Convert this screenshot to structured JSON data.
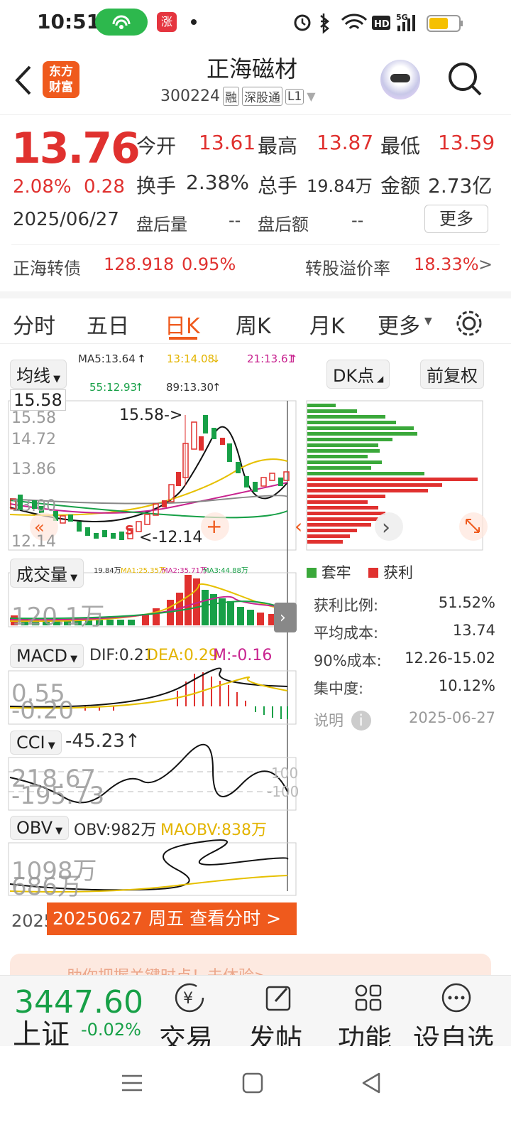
{
  "status": {
    "time": "10:51",
    "app_icon": "涨"
  },
  "header": {
    "title": "正海磁材",
    "code": "300224",
    "badge_rong": "融",
    "badge_sgt": "深股通",
    "badge_l1": "L1",
    "logo_text": "东方\n财富"
  },
  "quote": {
    "price": "13.76",
    "pct": "2.08%",
    "chg": "0.28",
    "date": "2025/06/27",
    "fields": [
      {
        "label": "今开",
        "value": "13.61"
      },
      {
        "label": "最高",
        "value": "13.87"
      },
      {
        "label": "最低",
        "value": "13.59"
      },
      {
        "label": "换手",
        "value": "2.38%"
      },
      {
        "label": "总手",
        "value": "19.84万"
      },
      {
        "label": "金额",
        "value": "2.73亿"
      },
      {
        "label": "盘后量",
        "value": "--"
      },
      {
        "label": "盘后额",
        "value": "--"
      }
    ],
    "more": "更多",
    "bond_label": "正海转债",
    "bond_price": "128.918",
    "bond_pct": "0.95%",
    "premium_label": "转股溢价率",
    "premium": "18.33%"
  },
  "tabs": [
    "分时",
    "五日",
    "日K",
    "周K",
    "月K",
    "更多"
  ],
  "chart": {
    "ma_select": "均线",
    "ma5": "MA5:13.64",
    "ma13": "13:14.08",
    "ma21": "21:13.61",
    "ma55": "55:12.93",
    "ma89": "89:13.30",
    "dk": "DK点",
    "fq": "前复权",
    "price_box": "15.58",
    "y1": "15.58",
    "y2": "14.72",
    "y3": "13.86",
    "y4": "13.00",
    "y5": "12.14",
    "high_note": "15.58->",
    "low_note": "<-12.14",
    "s_mark": "S",
    "vol_select": "成交量",
    "vol_line": "19.84万",
    "vma5": "MA1:25.35万",
    "vma10": "MA2:35.71万",
    "vma20": "MA3:44.88万",
    "vol_max": "120.1万",
    "macd_select": "MACD",
    "dif": "DIF:0.21",
    "dea": "DEA:0.29",
    "m": "M:-0.16",
    "macd_top": "0.55",
    "macd_bot": "-0.20",
    "cci_select": "CCI",
    "cci_val": "-45.23",
    "cci_top": "218.67",
    "cci_bot": "-195.73",
    "cci_100": "100",
    "cci_m100": "-100",
    "obv_select": "OBV",
    "obv_val": "OBV:982万",
    "maobv": "MAOBV:838万",
    "obv_top": "1098万",
    "obv_bot": "686万",
    "date_prefix": "2025",
    "banner": "20250627 周五 查看分时 >"
  },
  "chip": {
    "legend_trap": "套牢",
    "legend_profit": "获利",
    "rows": [
      {
        "label": "获利比例:",
        "value": "51.52%"
      },
      {
        "label": "平均成本:",
        "value": "13.74"
      },
      {
        "label": "90%成本:",
        "value": "12.26-15.02"
      },
      {
        "label": "集中度:",
        "value": "10.12%"
      }
    ],
    "note_label": "说明",
    "note_date": "2025-06-27"
  },
  "ad": {
    "text": "助你把握关键时点！去体验>"
  },
  "bottom": {
    "index_value": "3447.60",
    "index_name": "上证",
    "index_pct": "-0.02%",
    "items": [
      "交易",
      "发帖",
      "功能",
      "设自选"
    ]
  }
}
